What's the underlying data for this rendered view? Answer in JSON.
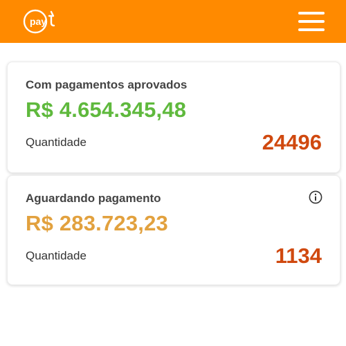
{
  "header": {
    "logo_text": "payt",
    "logo_icon": "payt-logo",
    "menu_icon": "hamburger-menu-icon",
    "background_color": "#ff8a00"
  },
  "cards": [
    {
      "title": "Com pagamentos aprovados",
      "amount": "R$ 4.654.345,48",
      "amount_color": "#5fb93d",
      "quantity_label": "Quantidade",
      "quantity_value": "24496"
    },
    {
      "title": "Aguardando pagamento",
      "amount": "R$ 283.723,23",
      "amount_color": "#e2a13e",
      "quantity_label": "Quantidade",
      "quantity_value": "1134",
      "info_icon": "info-icon"
    }
  ],
  "colors": {
    "quantity_value": "#d0490f",
    "title_text": "#444444"
  }
}
